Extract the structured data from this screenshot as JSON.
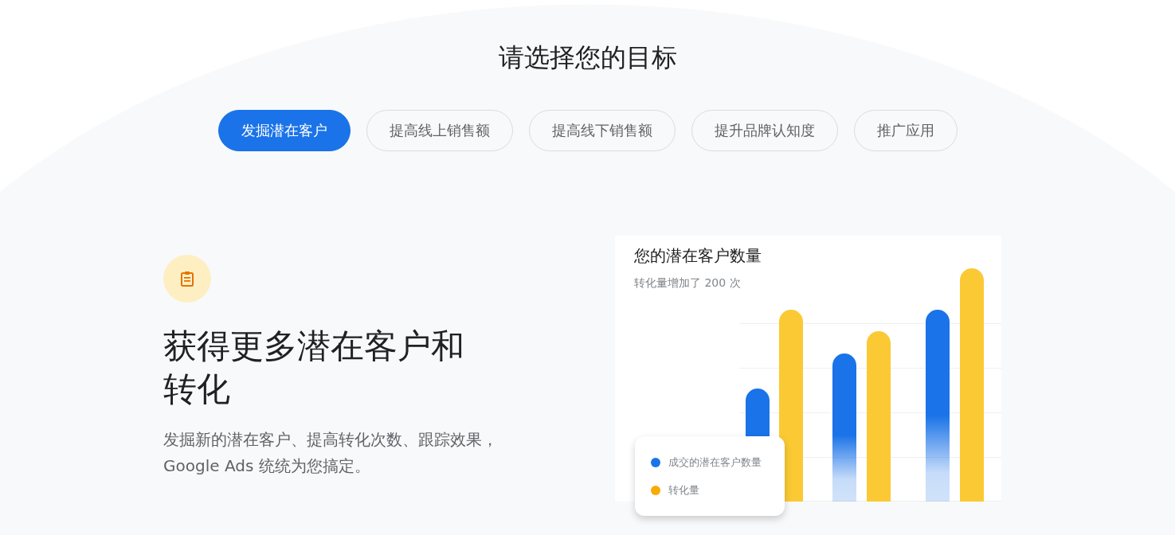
{
  "heading": "请选择您的目标",
  "tabs": [
    {
      "label": "发掘潜在客户",
      "selected": true
    },
    {
      "label": "提高线上销售额",
      "selected": false
    },
    {
      "label": "提高线下销售额",
      "selected": false
    },
    {
      "label": "提升品牌认知度",
      "selected": false
    },
    {
      "label": "推广应用",
      "selected": false
    }
  ],
  "feature": {
    "title": "获得更多潜在客户和转化",
    "description": "发掘新的潜在客户、提高转化次数、跟踪效果，Google Ads 统统为您搞定。"
  },
  "chart_card": {
    "title": "您的潜在客户数量",
    "subtitle": "转化量增加了 200 次",
    "legend": [
      {
        "label": "成交的潜在客户数量",
        "color": "#1a73e8"
      },
      {
        "label": "转化量",
        "color": "#f9ab00"
      }
    ]
  }
}
